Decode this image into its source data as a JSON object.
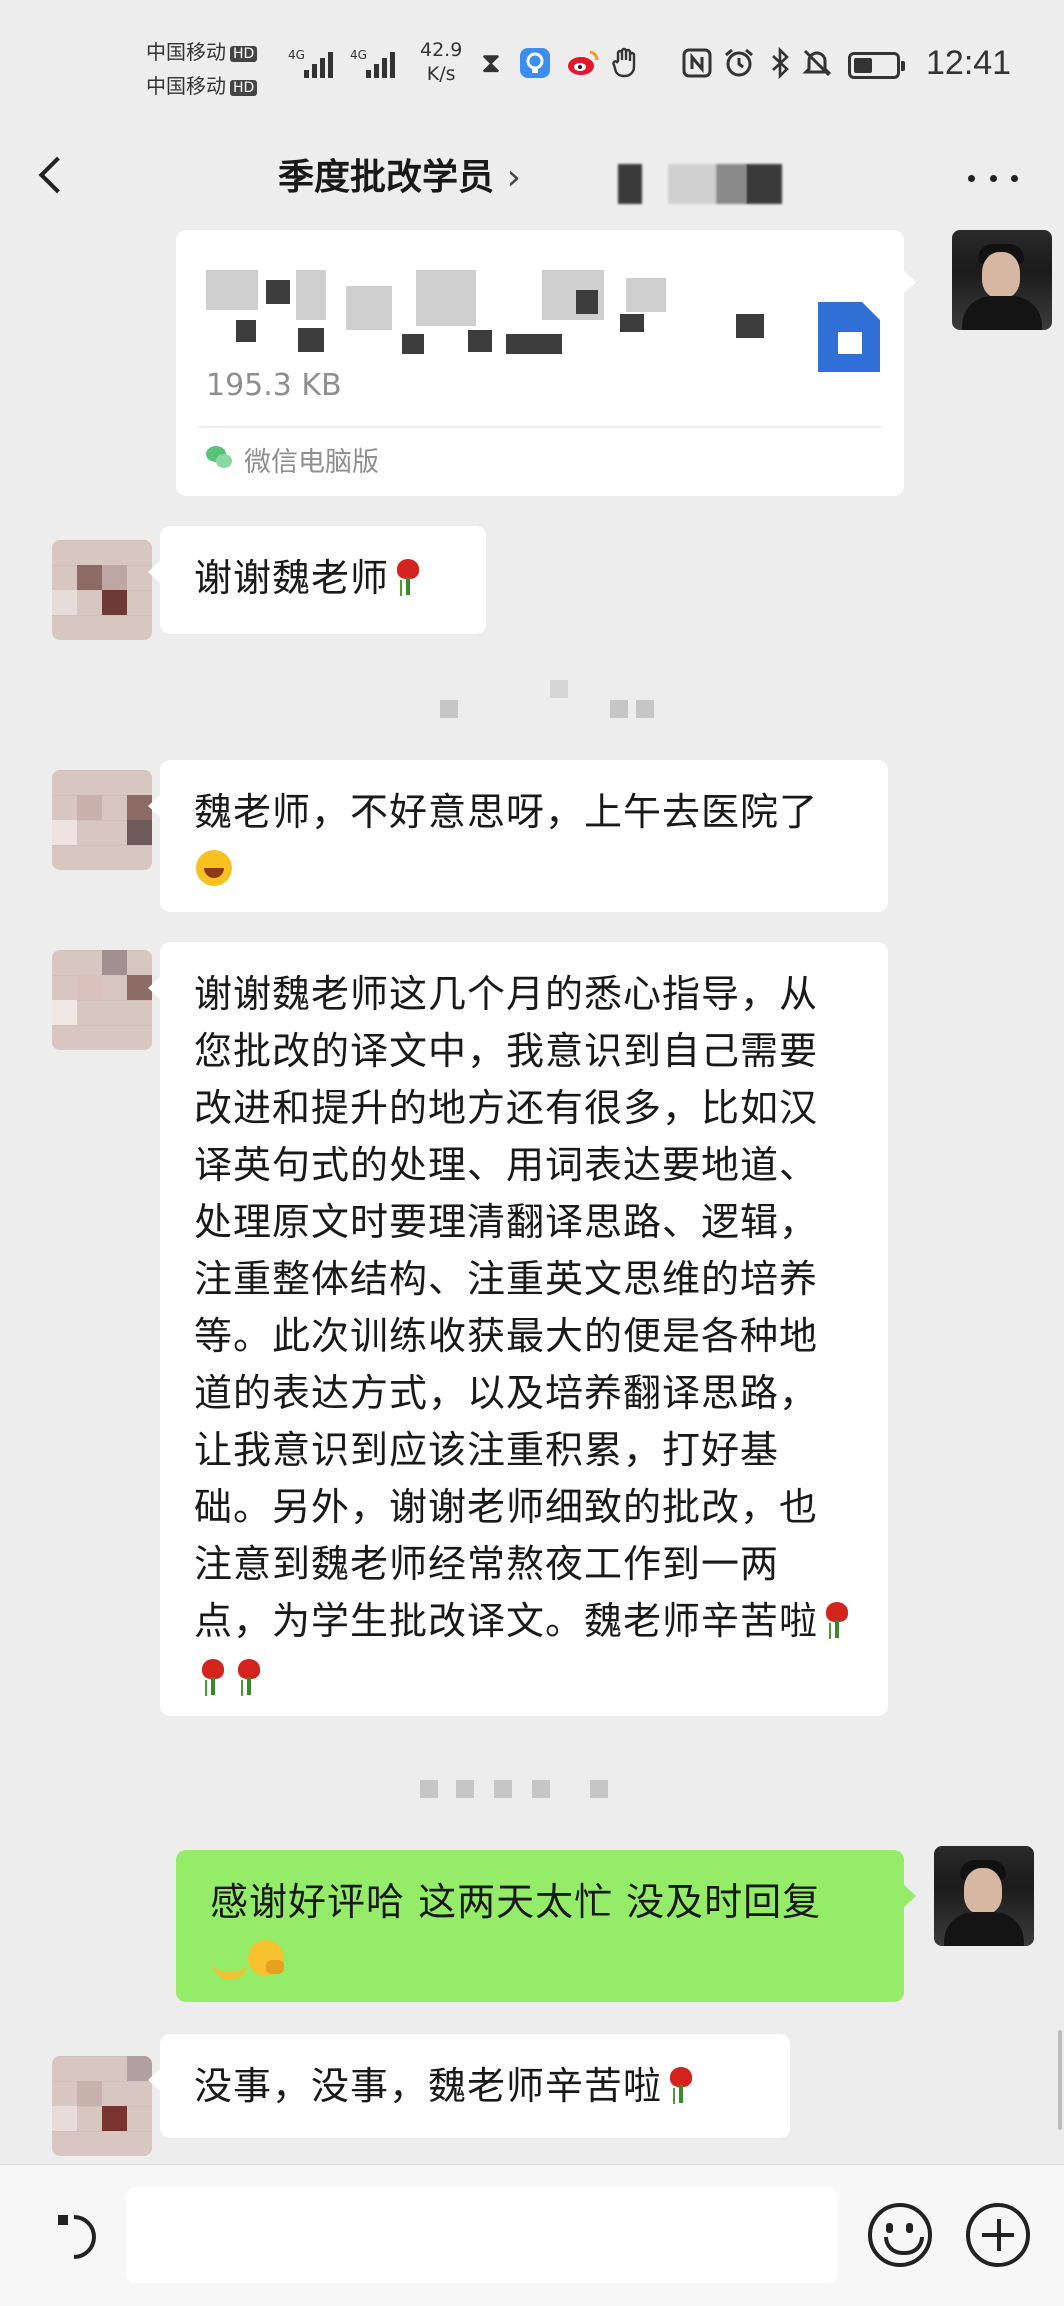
{
  "status_bar": {
    "carrier_1": "中国移动",
    "carrier_2": "中国移动",
    "hd_badge": "HD",
    "net_speed_value": "42.9",
    "net_speed_unit": "K/s",
    "time": "12:41",
    "icons": [
      "hourglass-icon",
      "bulb-app-icon",
      "weibo-icon",
      "hand-icon",
      "nfc-icon",
      "alarm-icon",
      "bluetooth-icon",
      "mute-icon",
      "battery-icon"
    ]
  },
  "header": {
    "title": "季度批改学员",
    "title_suffix": "›"
  },
  "file_card": {
    "size": "195.3 KB",
    "source": "微信电脑版"
  },
  "messages": [
    {
      "side": "left",
      "text": "谢谢魏老师",
      "trailing_emoji": [
        "rose"
      ]
    },
    {
      "side": "left",
      "text": "魏老师，不好意思呀，上午去医院了",
      "trailing_emoji": [
        "laugh-cry"
      ]
    },
    {
      "side": "left",
      "text": "谢谢魏老师这几个月的悉心指导，从您批改的译文中，我意识到自己需要改进和提升的地方还有很多，比如汉译英句式的处理、用词表达要地道、处理原文时要理清翻译思路、逻辑，注重整体结构、注重英文思维的培养等。此次训练收获最大的便是各种地道的表达方式，以及培养翻译思路，让我意识到应该注重积累，打好基础。另外，谢谢老师细致的批改，也注意到魏老师经常熬夜工作到一两点，为学生批改译文。魏老师辛苦啦",
      "trailing_emoji": [
        "rose",
        "rose",
        "rose"
      ]
    },
    {
      "side": "right",
      "text": "感谢好评哈 这两天太忙 没及时回复",
      "trailing_emoji": [
        "banana",
        "shy"
      ]
    },
    {
      "side": "left",
      "text": "没事，没事，魏老师辛苦啦",
      "trailing_emoji": [
        "rose"
      ]
    }
  ],
  "colors": {
    "background": "#ededed",
    "bubble_self": "#95ec69",
    "bubble_other": "#ffffff",
    "file_icon": "#2f6fd6"
  }
}
